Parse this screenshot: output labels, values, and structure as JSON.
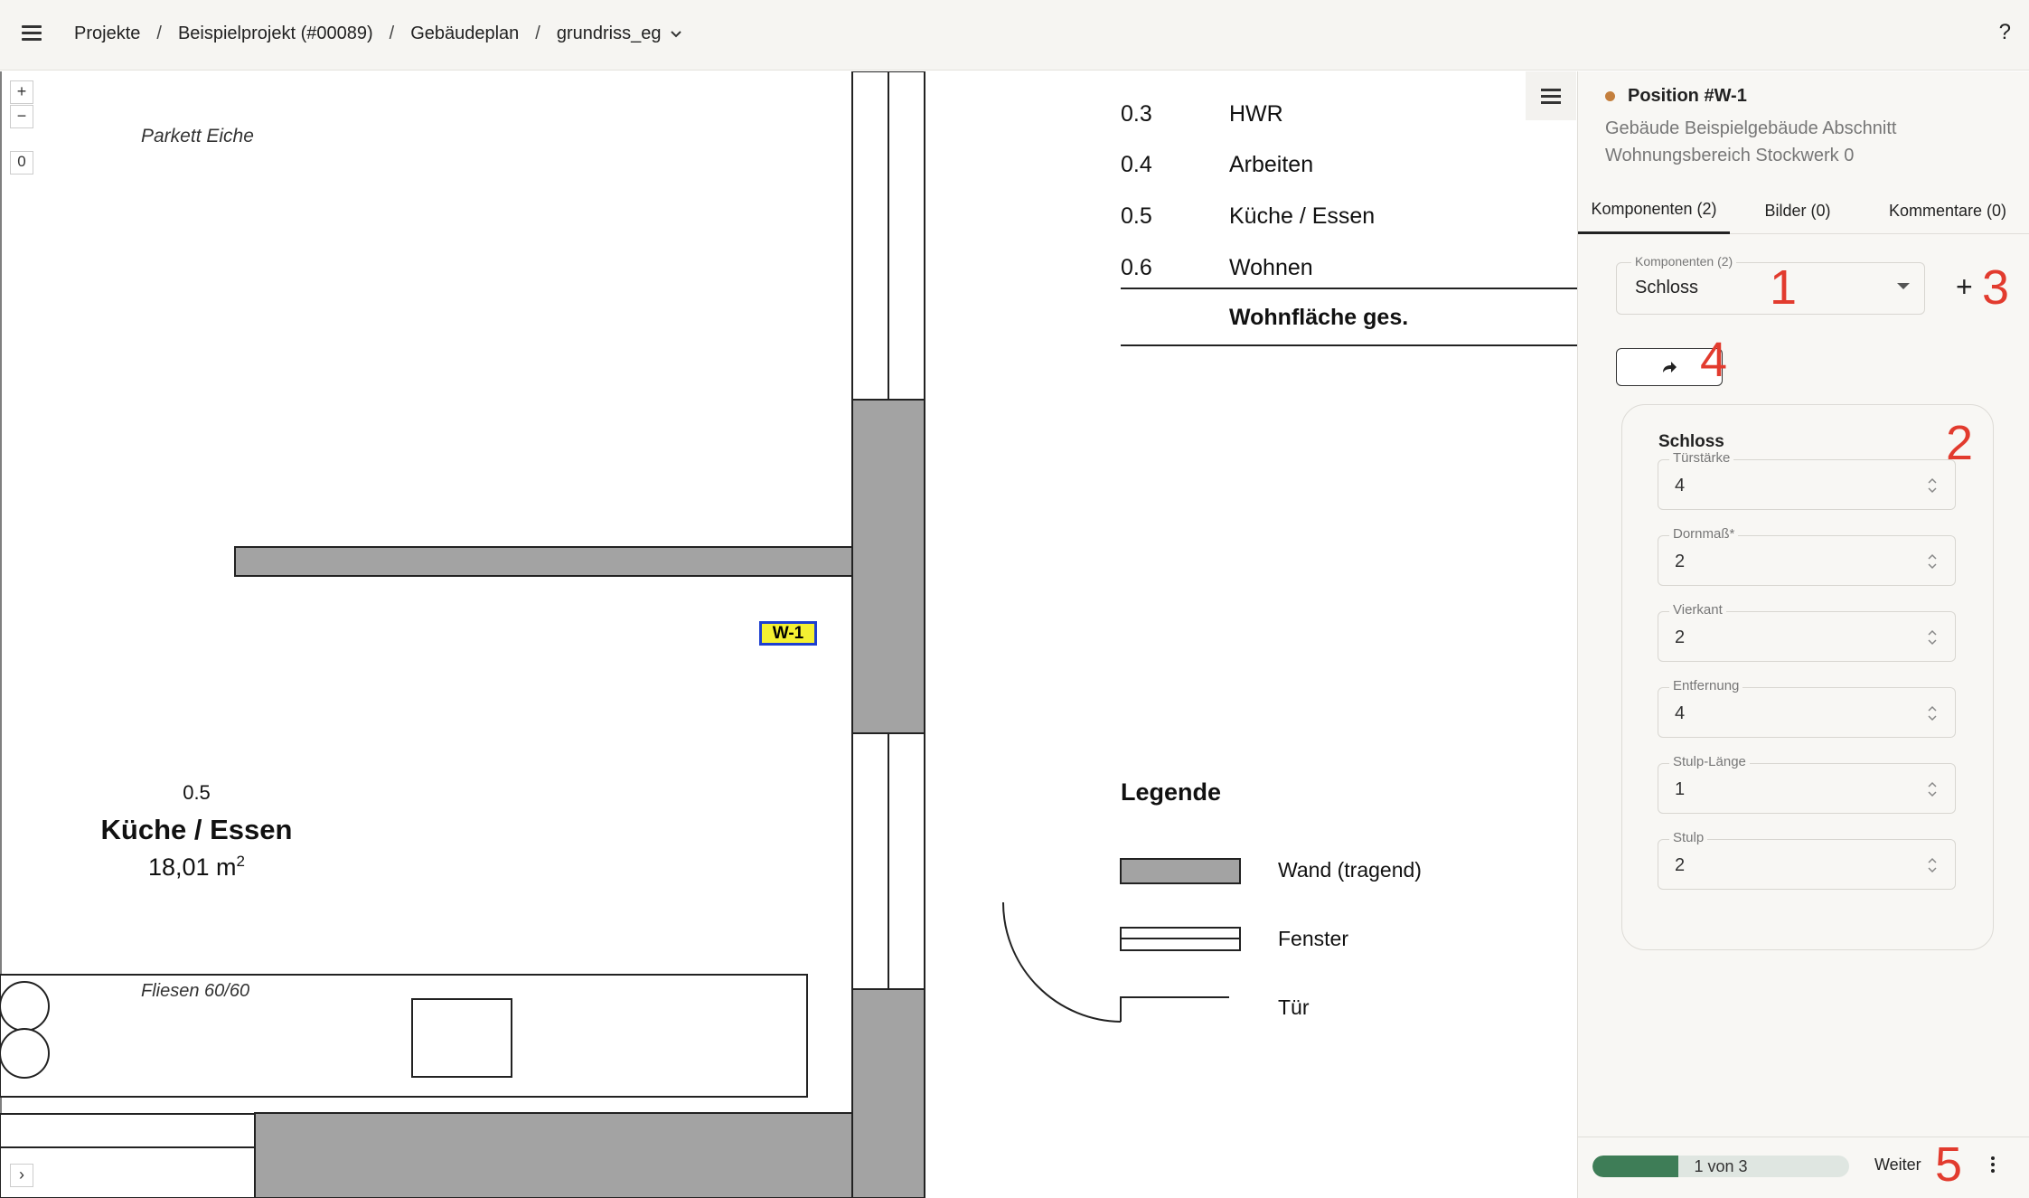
{
  "topbar": {
    "breadcrumb": [
      "Projekte",
      "Beispielprojekt (#00089)",
      "Gebäudeplan",
      "grundriss_eg"
    ],
    "separator": "/",
    "help_label": "?"
  },
  "plan_controls": {
    "zoom_in": "+",
    "zoom_out": "−",
    "rotation": "0",
    "expand": "›"
  },
  "plan": {
    "floor_top_label": "Parkett Eiche",
    "floor_bottom_label": "Fliesen 60/60",
    "room_number": "0.5",
    "room_name": "Küche / Essen",
    "room_area": "18,01 m",
    "room_area_sup": "2",
    "marker_label": "W-1",
    "room_table": [
      {
        "num": "0.3",
        "name": "HWR"
      },
      {
        "num": "0.4",
        "name": "Arbeiten"
      },
      {
        "num": "0.5",
        "name": "Küche / Essen"
      },
      {
        "num": "0.6",
        "name": "Wohnen"
      }
    ],
    "room_table_total": "Wohnfläche ges.",
    "legend_title": "Legende",
    "legend_items": [
      "Wand (tragend)",
      "Fenster",
      "Tür"
    ]
  },
  "panel": {
    "position_title": "Position #W-1",
    "position_subtitle": "Gebäude Beispielgebäude Abschnitt Wohnungsbereich Stockwerk 0",
    "status_color": "#c47f3d",
    "tabs": [
      "Komponenten (2)",
      "Bilder (0)",
      "Kommentare (0)"
    ],
    "select_label": "Komponenten (2)",
    "select_value": "Schloss",
    "add_label": "+",
    "component_title": "Schloss",
    "fields": [
      {
        "label": "Türstärke",
        "value": "4"
      },
      {
        "label": "Dornmaß*",
        "value": "2"
      },
      {
        "label": "Vierkant",
        "value": "2"
      },
      {
        "label": "Entfernung",
        "value": "4"
      },
      {
        "label": "Stulp-Länge",
        "value": "1"
      },
      {
        "label": "Stulp",
        "value": "2"
      }
    ],
    "progress_text": "1 von 3",
    "progress_fraction": 0.333,
    "progress_color": "#3e7d57",
    "next_label": "Weiter"
  },
  "annotations": [
    "1",
    "2",
    "3",
    "4",
    "5"
  ]
}
